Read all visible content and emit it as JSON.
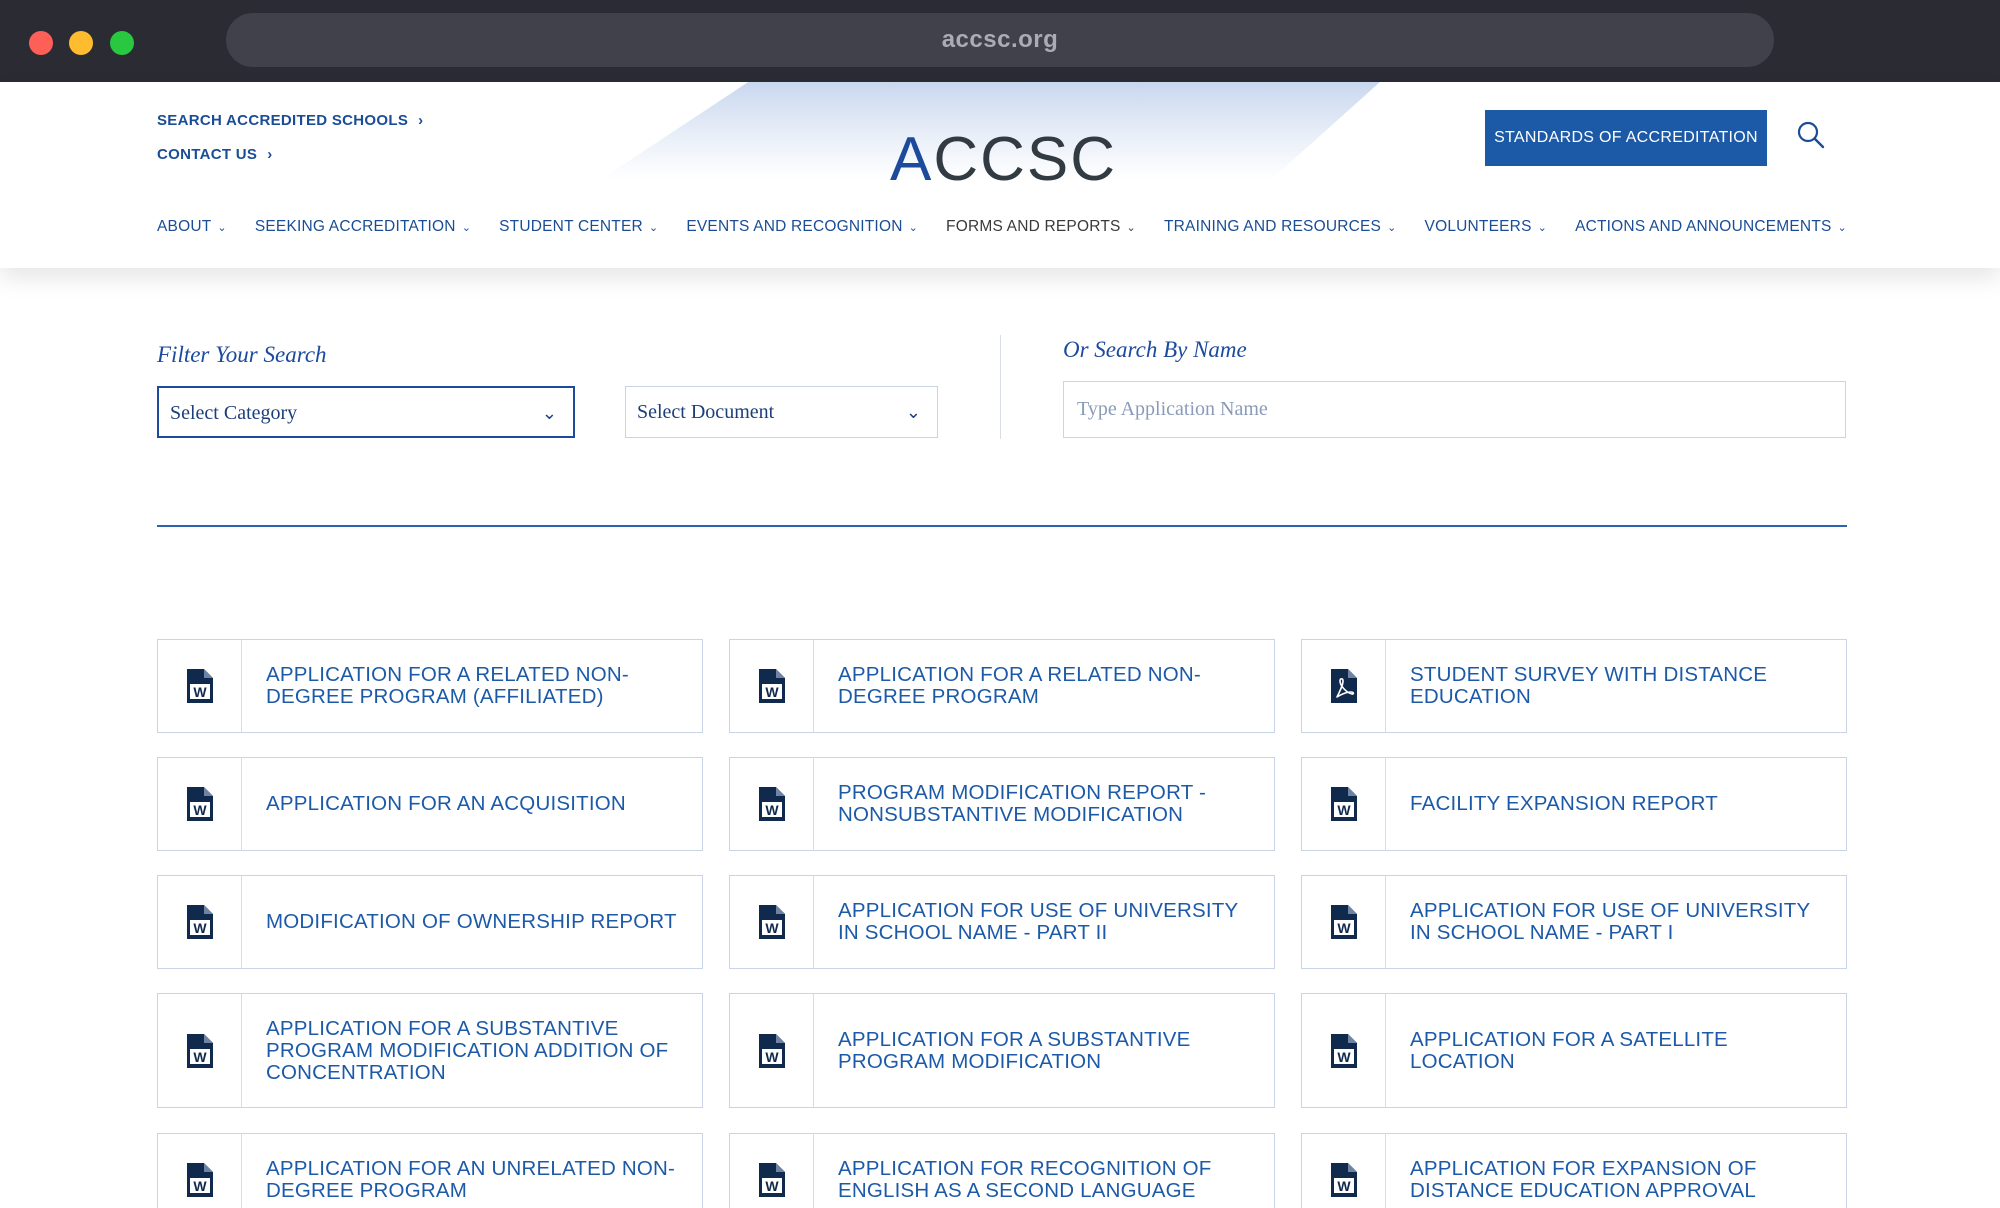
{
  "browser": {
    "url": "accsc.org"
  },
  "header": {
    "logo_text": "ACCSC",
    "util_links": [
      {
        "label": "SEARCH ACCREDITED SCHOOLS"
      },
      {
        "label": "CONTACT US"
      }
    ],
    "standards_button": "STANDARDS OF ACCREDITATION",
    "nav": [
      {
        "label": "ABOUT"
      },
      {
        "label": "SEEKING ACCREDITATION"
      },
      {
        "label": "STUDENT CENTER"
      },
      {
        "label": "EVENTS AND RECOGNITION"
      },
      {
        "label": "FORMS AND REPORTS"
      },
      {
        "label": "TRAINING AND RESOURCES"
      },
      {
        "label": "VOLUNTEERS"
      },
      {
        "label": "ACTIONS AND ANNOUNCEMENTS"
      }
    ]
  },
  "filter": {
    "label": "Filter Your Search",
    "category_select": "Select Category",
    "document_select": "Select Document",
    "name_label": "Or Search By Name",
    "name_placeholder": "Type Application Name"
  },
  "documents": [
    {
      "title": "APPLICATION FOR A RELATED NON-DEGREE PROGRAM (AFFILIATED)",
      "icon": "word-doc-icon"
    },
    {
      "title": "APPLICATION FOR A RELATED NON-DEGREE PROGRAM",
      "icon": "word-doc-icon"
    },
    {
      "title": "STUDENT SURVEY WITH DISTANCE EDUCATION",
      "icon": "pdf-doc-icon"
    },
    {
      "title": "APPLICATION FOR AN ACQUISITION",
      "icon": "word-doc-icon"
    },
    {
      "title": "PROGRAM MODIFICATION REPORT - NONSUBSTANTIVE MODIFICATION",
      "icon": "word-doc-icon"
    },
    {
      "title": "FACILITY EXPANSION REPORT",
      "icon": "word-doc-icon"
    },
    {
      "title": "MODIFICATION OF OWNERSHIP REPORT",
      "icon": "word-doc-icon"
    },
    {
      "title": "APPLICATION FOR USE OF UNIVERSITY IN SCHOOL NAME - PART II",
      "icon": "word-doc-icon"
    },
    {
      "title": "APPLICATION FOR USE OF UNIVERSITY IN SCHOOL NAME - PART I",
      "icon": "word-doc-icon"
    },
    {
      "title": "APPLICATION FOR A SUBSTANTIVE PROGRAM MODIFICATION ADDITION OF CONCENTRATION",
      "icon": "word-doc-icon"
    },
    {
      "title": "APPLICATION FOR A SUBSTANTIVE PROGRAM MODIFICATION",
      "icon": "word-doc-icon"
    },
    {
      "title": "APPLICATION FOR A SATELLITE LOCATION",
      "icon": "word-doc-icon"
    },
    {
      "title": "APPLICATION FOR AN UNRELATED NON-DEGREE PROGRAM",
      "icon": "word-doc-icon"
    },
    {
      "title": "APPLICATION FOR RECOGNITION OF ENGLISH AS A SECOND LANGUAGE",
      "icon": "word-doc-icon"
    },
    {
      "title": "APPLICATION FOR EXPANSION OF DISTANCE EDUCATION APPROVAL",
      "icon": "word-doc-icon"
    }
  ],
  "colors": {
    "brand_blue": "#1c5aa8",
    "link_blue": "#1a4d96",
    "icon_navy": "#0f2a4d"
  }
}
